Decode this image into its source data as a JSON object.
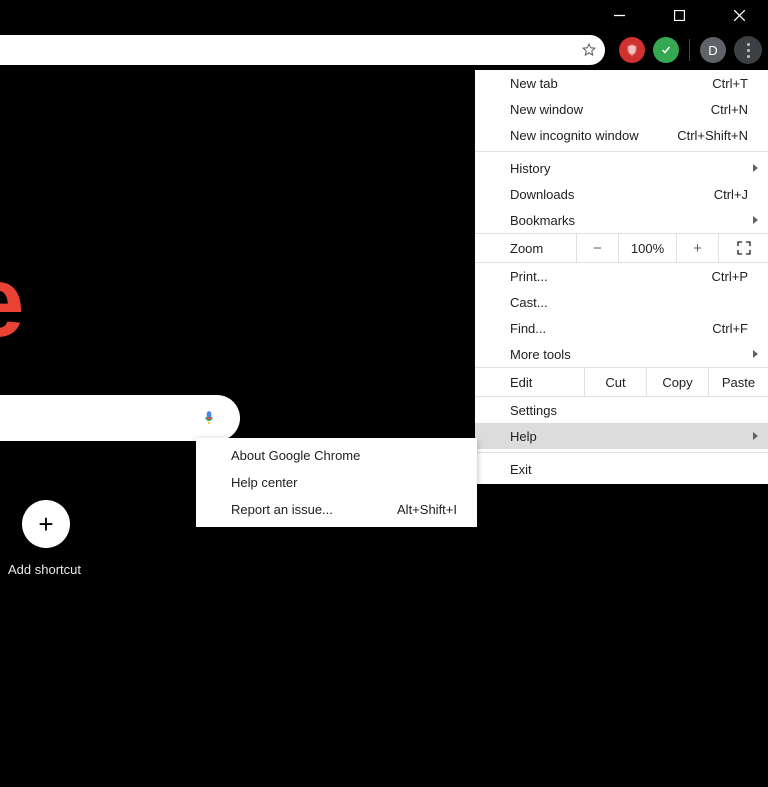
{
  "window_controls": {
    "minimize": "minimize",
    "maximize": "maximize",
    "close": "close"
  },
  "toolbar": {
    "profile_initial": "D"
  },
  "page": {
    "logo_fragment": "gle",
    "add_shortcut_label": "Add shortcut"
  },
  "menu": {
    "new_tab": {
      "label": "New tab",
      "accel": "Ctrl+T"
    },
    "new_window": {
      "label": "New window",
      "accel": "Ctrl+N"
    },
    "new_incognito": {
      "label": "New incognito window",
      "accel": "Ctrl+Shift+N"
    },
    "history": {
      "label": "History"
    },
    "downloads": {
      "label": "Downloads",
      "accel": "Ctrl+J"
    },
    "bookmarks": {
      "label": "Bookmarks"
    },
    "zoom_label": "Zoom",
    "zoom_minus": "−",
    "zoom_value": "100%",
    "zoom_plus": "+",
    "print": {
      "label": "Print...",
      "accel": "Ctrl+P"
    },
    "cast": {
      "label": "Cast..."
    },
    "find": {
      "label": "Find...",
      "accel": "Ctrl+F"
    },
    "more_tools": {
      "label": "More tools"
    },
    "edit_label": "Edit",
    "cut": "Cut",
    "copy": "Copy",
    "paste": "Paste",
    "settings": {
      "label": "Settings"
    },
    "help": {
      "label": "Help"
    },
    "exit": {
      "label": "Exit"
    }
  },
  "help_submenu": {
    "about": {
      "label": "About Google Chrome"
    },
    "center": {
      "label": "Help center"
    },
    "report": {
      "label": "Report an issue...",
      "accel": "Alt+Shift+I"
    }
  }
}
